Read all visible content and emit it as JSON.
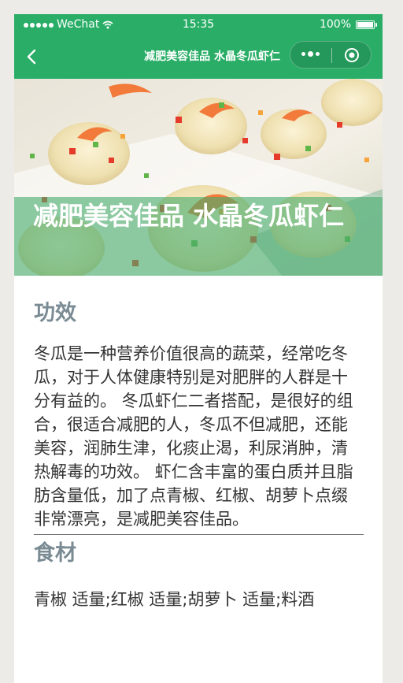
{
  "status_bar": {
    "carrier": "WeChat",
    "time": "15:35",
    "battery": "100%"
  },
  "nav": {
    "title": "减肥美容佳品 水晶冬瓜虾仁"
  },
  "hero": {
    "heading": "减肥美容佳品 水晶冬瓜虾仁"
  },
  "sections": {
    "effect_title": "功效",
    "effect_text": "冬瓜是一种营养价值很高的蔬菜，经常吃冬瓜，对于人体健康特别是对肥胖的人群是十分有益的。 冬瓜虾仁二者搭配，是很好的组合，很适合减肥的人，冬瓜不但减肥，还能美容，润肺生津，化痰止渴，利尿消肿，清热解毒的功效。 虾仁含丰富的蛋白质并且脂肪含量低，加了点青椒、红椒、胡萝卜点缀非常漂亮，是减肥美容佳品。",
    "ingredients_title": "食材",
    "ingredients_text": "青椒 适量;红椒 适量;胡萝卜 适量;料酒"
  },
  "colors": {
    "brand_green": "#2aae67",
    "section_title": "#7a8b94"
  }
}
